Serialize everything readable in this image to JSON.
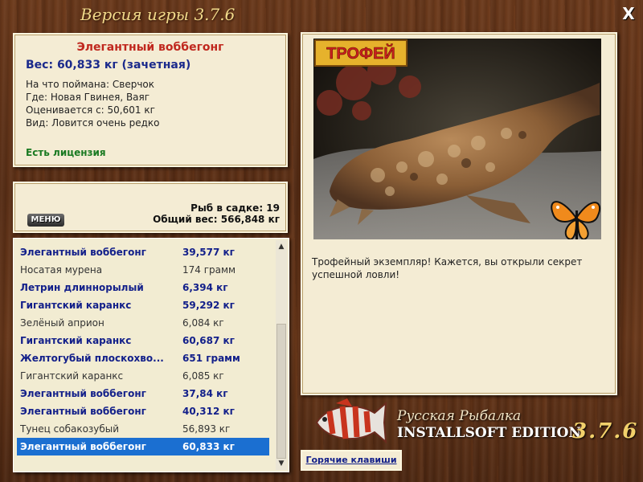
{
  "window": {
    "title": "Версия игры 3.7.6",
    "close_label": "X"
  },
  "info": {
    "fish_name": "Элегантный воббегонг",
    "weight": "Вес: 60,833 кг (зачетная)",
    "caught_on": "На что поймана: Сверчок",
    "location": "Где: Новая Гвинея, Ваяг",
    "valued_from": "Оценивается с: 50,601 кг",
    "rarity": "Вид: Ловится очень редко",
    "license": "Есть лицензия"
  },
  "stats": {
    "menu_label": "МЕНЮ",
    "fish_count": "Рыб в садке: 19",
    "total_weight": "Общий вес: 566,848 кг"
  },
  "catch_list": [
    {
      "name": "Элегантный воббегонг",
      "weight": "39,577 кг",
      "bold": true
    },
    {
      "name": "Носатая мурена",
      "weight": "174 грамм",
      "bold": false
    },
    {
      "name": "Летрин длиннорылый",
      "weight": "6,394 кг",
      "bold": true
    },
    {
      "name": "Гигантский каранкс",
      "weight": "59,292 кг",
      "bold": true
    },
    {
      "name": "Зелёный априон",
      "weight": "6,084 кг",
      "bold": false
    },
    {
      "name": "Гигантский каранкс",
      "weight": "60,687 кг",
      "bold": true
    },
    {
      "name": "Желтогубый плоскохво...",
      "weight": "651 грамм",
      "bold": true
    },
    {
      "name": "Гигантский каранкс",
      "weight": "6,085 кг",
      "bold": false
    },
    {
      "name": "Элегантный воббегонг",
      "weight": "37,84 кг",
      "bold": true
    },
    {
      "name": "Элегантный воббегонг",
      "weight": "40,312 кг",
      "bold": true
    },
    {
      "name": "Тунец собакозубый",
      "weight": "56,893 кг",
      "bold": false
    },
    {
      "name": "Элегантный воббегонг",
      "weight": "60,833 кг",
      "bold": true,
      "selected": true
    }
  ],
  "trophy": {
    "badge": "ТРОФЕЙ",
    "description": "Трофейный экземпляр! Кажется, вы открыли секрет успешной ловли!"
  },
  "footer": {
    "hotkeys": "Горячие клавиши",
    "brand_line1": "Русская Рыбалка",
    "brand_line2": "INSTALLSOFT EDITION",
    "version": "3.7.6"
  },
  "colors": {
    "fish_name": "#c0281e",
    "weight": "#1b2a8c",
    "license": "#1a7a22",
    "selected_row": "#1b6fd1"
  },
  "icons": {
    "close": "close-icon",
    "scroll_up": "chevron-up-icon",
    "scroll_down": "chevron-down-icon",
    "butterfly": "butterfly-icon",
    "logo_fish": "fish-logo-icon"
  }
}
